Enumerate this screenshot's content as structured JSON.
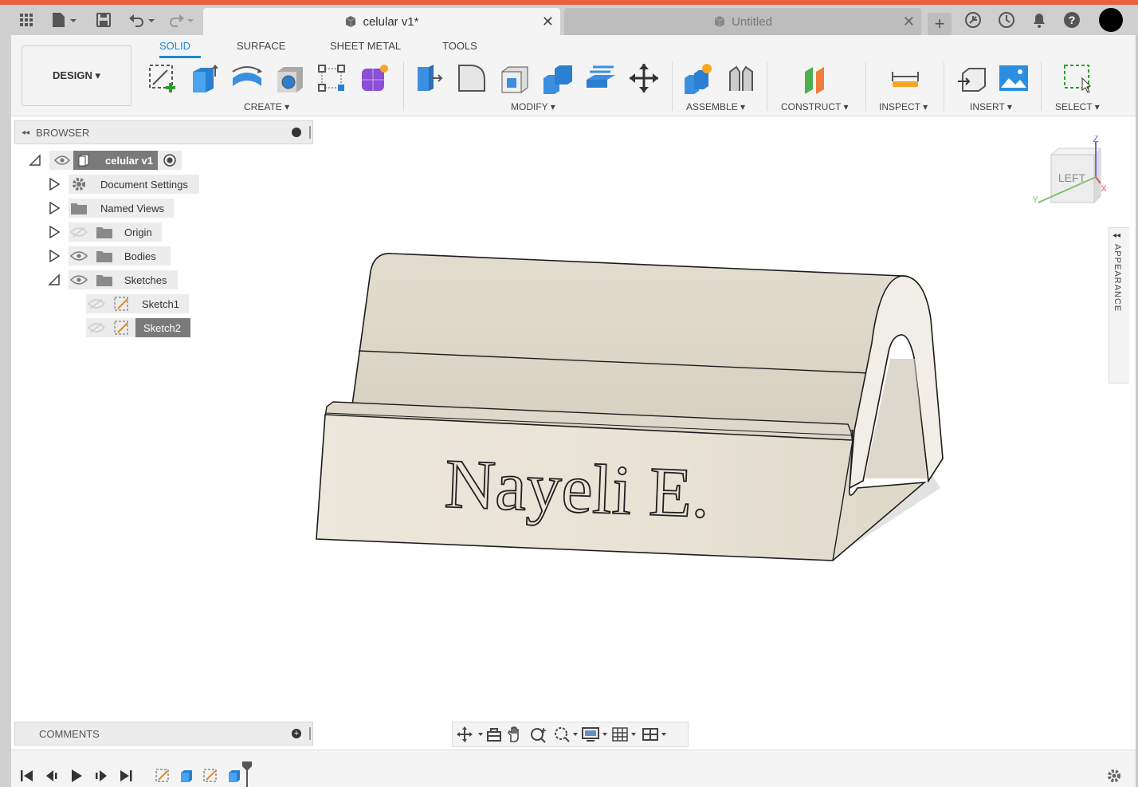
{
  "tabs": {
    "active_title": "celular v1*",
    "inactive_title": "Untitled"
  },
  "toolbar": {
    "design_label": "DESIGN ▾",
    "workspace_tabs": [
      "SOLID",
      "SURFACE",
      "SHEET METAL",
      "TOOLS"
    ],
    "groups": {
      "create": "CREATE ▾",
      "modify": "MODIFY ▾",
      "assemble": "ASSEMBLE ▾",
      "construct": "CONSTRUCT ▾",
      "inspect": "INSPECT ▾",
      "insert": "INSERT ▾",
      "select": "SELECT ▾"
    }
  },
  "browser": {
    "title": "BROWSER",
    "root": "celular v1",
    "items": [
      "Document Settings",
      "Named Views",
      "Origin",
      "Bodies",
      "Sketches"
    ],
    "sketches": [
      "Sketch1",
      "Sketch2"
    ]
  },
  "viewport": {
    "model_text": "Nayeli E.",
    "viewcube_face": "LEFT",
    "axis_z": "Z",
    "axis_y": "Y",
    "axis_x": "X",
    "appearance_label": "APPEARANCE"
  },
  "comments": {
    "title": "COMMENTS"
  },
  "colors": {
    "accent": "#e8603f",
    "active_tab": "#1e8bd6",
    "model": "#e6e1d3"
  }
}
